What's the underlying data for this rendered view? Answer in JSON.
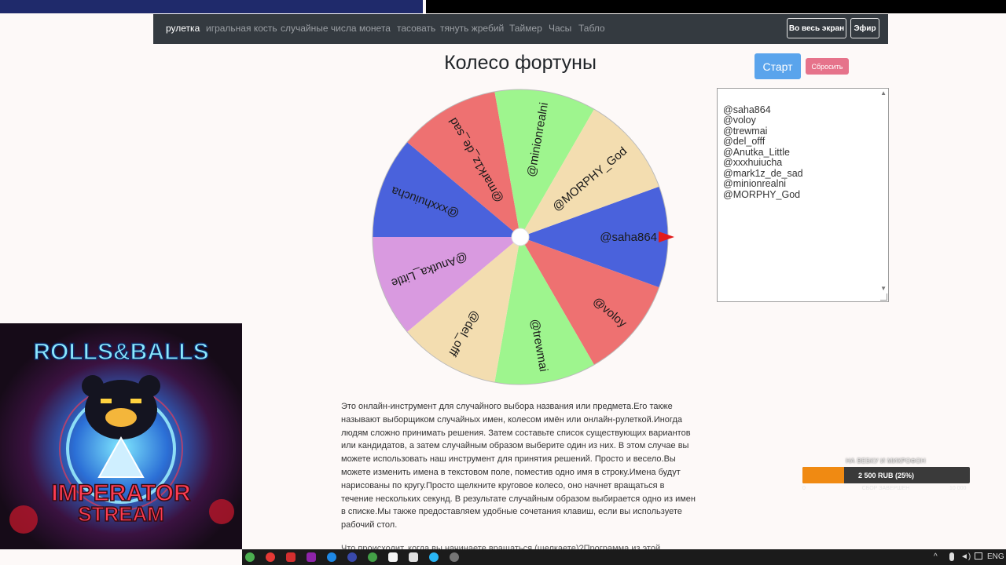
{
  "nav": {
    "items": [
      "рулетка",
      "игральная кость",
      "случайные числа",
      "монета",
      "тасовать",
      "тянуть жребий",
      "Таймер",
      "Часы",
      "Табло"
    ],
    "fullscreen_label": "Во весь экран",
    "broadcast_label": "Эфир"
  },
  "page": {
    "title": "Колесо фортуны",
    "start_label": "Старт",
    "reset_label": "Сбросить"
  },
  "names": [
    "@saha864",
    "@voloy",
    "@trewmai",
    "@del_offf",
    "@Anutka_Little",
    "@xxxhuiucha",
    "@mark1z_de_sad",
    "@minionrealni",
    "@MORPHY_God"
  ],
  "wheel": {
    "segments": [
      {
        "label": "@saha864",
        "color": "#4a62dc"
      },
      {
        "label": "@voloy",
        "color": "#ee7171"
      },
      {
        "label": "@trewmai",
        "color": "#9ef58e"
      },
      {
        "label": "@del_offf",
        "color": "#f3ddb0"
      },
      {
        "label": "@Anutka_Little",
        "color": "#d99ae0"
      },
      {
        "label": "@xxxhuiucha",
        "color": "#4a62dc"
      },
      {
        "label": "@mark1z_de_sad",
        "color": "#ee7171"
      },
      {
        "label": "@minionrealni",
        "color": "#9ef58e"
      },
      {
        "label": "@MORPHY_God",
        "color": "#f3ddb0"
      }
    ],
    "pointer_color": "#e21b1b"
  },
  "description": "Это онлайн-инструмент для случайного выбора названия или предмета.Его также называют выборщиком случайных имен, колесом имён или онлайн-рулеткой.Иногда людям сложно принимать решения. Затем составьте список существующих вариантов или кандидатов, а затем случайным образом выберите один из них. В этом случае вы можете использовать наш инструмент для принятия решений. Просто и весело.Вы можете изменить имена в текстовом поле, поместив одно имя в строку.Имена будут нарисованы по кругу.Просто щелкните круговое колесо, оно начнет вращаться в течение нескольких секунд. В результате случайным образом выбирается одно из имен в списке.Мы также предоставляем удобные сочетания клавиш, если вы используете рабочий стол.",
  "description_next": "Что происходит, когда вы начинаете вращаться (щелкаете)?Программа из этой",
  "overlay": {
    "line1": "ROLLS&BALLS",
    "line2": "IMPERATOR",
    "line3": "STREAM"
  },
  "donation": {
    "title": "НА ВЕБКУ И МИКРОФОН",
    "text": "2 500 RUB (25%)",
    "progress": 0.25,
    "min": "0",
    "max": "10 000",
    "sub": "СБОР ЗАВЕРШЕН"
  },
  "taskbar": {
    "language": "ENG"
  }
}
